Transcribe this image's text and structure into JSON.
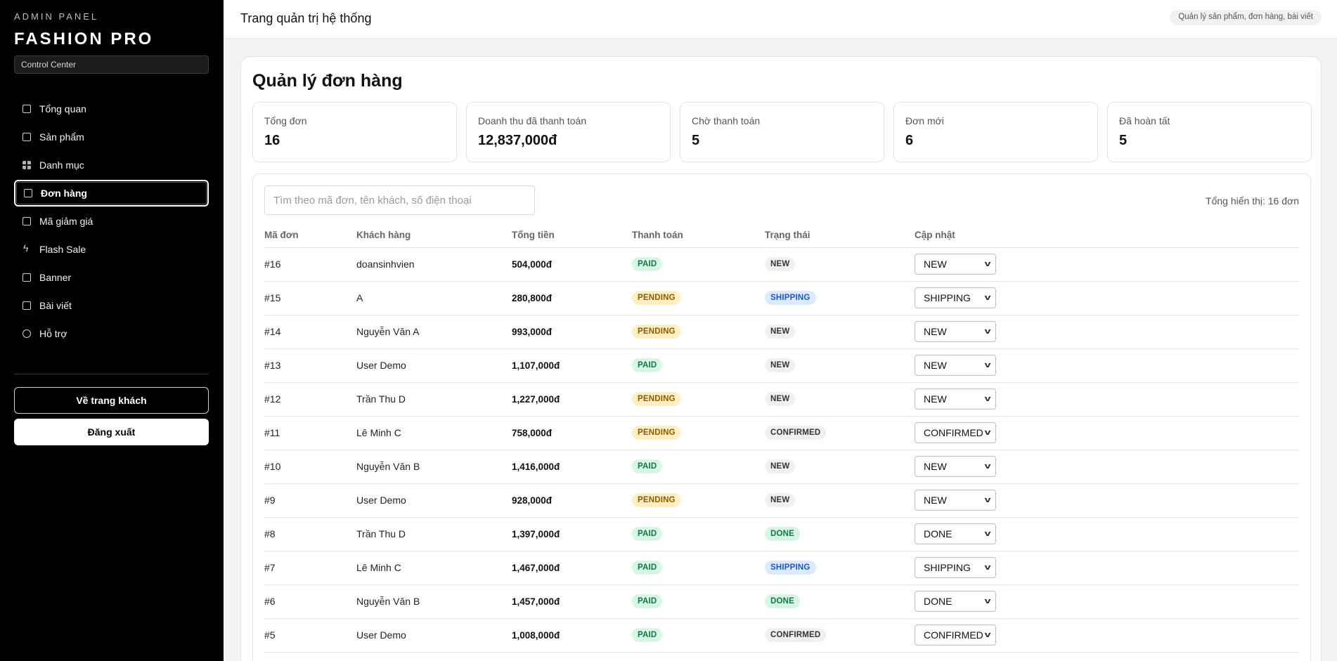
{
  "sidebar": {
    "brand_small": "ADMIN PANEL",
    "brand_big": "FASHION PRO",
    "brand_sub": "Control Center",
    "items": [
      {
        "label": "Tổng quan",
        "icon": "chart-icon"
      },
      {
        "label": "Sản phẩm",
        "icon": "box-icon"
      },
      {
        "label": "Danh mục",
        "icon": "grid-icon"
      },
      {
        "label": "Đơn hàng",
        "icon": "clipboard-icon",
        "active": true
      },
      {
        "label": "Mã giảm giá",
        "icon": "ticket-icon"
      },
      {
        "label": "Flash Sale",
        "icon": "bolt-icon"
      },
      {
        "label": "Banner",
        "icon": "image-icon"
      },
      {
        "label": "Bài viết",
        "icon": "newspaper-icon"
      },
      {
        "label": "Hỗ trợ",
        "icon": "globe-icon"
      }
    ],
    "home_button": "Về trang khách",
    "logout_button": "Đăng xuất"
  },
  "header": {
    "title": "Trang quản trị hệ thống",
    "pill": "Quản lý sản phẩm, đơn hàng, bài viết"
  },
  "main": {
    "title": "Quản lý đơn hàng",
    "stats": [
      {
        "label": "Tổng đơn",
        "value": "16"
      },
      {
        "label": "Doanh thu đã thanh toán",
        "value": "12,837,000đ"
      },
      {
        "label": "Chờ thanh toán",
        "value": "5"
      },
      {
        "label": "Đơn mới",
        "value": "6"
      },
      {
        "label": "Đã hoàn tất",
        "value": "5"
      }
    ],
    "search": {
      "placeholder": "Tìm theo mã đơn, tên khách, số điện thoại",
      "value": ""
    },
    "total_note": "Tổng hiển thị: 16 đơn",
    "columns": [
      "Mã đơn",
      "Khách hàng",
      "Tổng tiền",
      "Thanh toán",
      "Trạng thái",
      "Cập nhật"
    ],
    "rows": [
      {
        "id": "#16",
        "customer": "doansinhvien",
        "total": "504,000đ",
        "payment": "PAID",
        "status": "NEW",
        "update": "NEW"
      },
      {
        "id": "#15",
        "customer": "A",
        "total": "280,800đ",
        "payment": "PENDING",
        "status": "SHIPPING",
        "update": "SHIPPING"
      },
      {
        "id": "#14",
        "customer": "Nguyễn Văn A",
        "total": "993,000đ",
        "payment": "PENDING",
        "status": "NEW",
        "update": "NEW"
      },
      {
        "id": "#13",
        "customer": "User Demo",
        "total": "1,107,000đ",
        "payment": "PAID",
        "status": "NEW",
        "update": "NEW"
      },
      {
        "id": "#12",
        "customer": "Trần Thu D",
        "total": "1,227,000đ",
        "payment": "PENDING",
        "status": "NEW",
        "update": "NEW"
      },
      {
        "id": "#11",
        "customer": "Lê Minh C",
        "total": "758,000đ",
        "payment": "PENDING",
        "status": "CONFIRMED",
        "update": "CONFIRMED"
      },
      {
        "id": "#10",
        "customer": "Nguyễn Văn B",
        "total": "1,416,000đ",
        "payment": "PAID",
        "status": "NEW",
        "update": "NEW"
      },
      {
        "id": "#9",
        "customer": "User Demo",
        "total": "928,000đ",
        "payment": "PENDING",
        "status": "NEW",
        "update": "NEW"
      },
      {
        "id": "#8",
        "customer": "Trần Thu D",
        "total": "1,397,000đ",
        "payment": "PAID",
        "status": "DONE",
        "update": "DONE"
      },
      {
        "id": "#7",
        "customer": "Lê Minh C",
        "total": "1,467,000đ",
        "payment": "PAID",
        "status": "SHIPPING",
        "update": "SHIPPING"
      },
      {
        "id": "#6",
        "customer": "Nguyễn Văn B",
        "total": "1,457,000đ",
        "payment": "PAID",
        "status": "DONE",
        "update": "DONE"
      },
      {
        "id": "#5",
        "customer": "User Demo",
        "total": "1,008,000đ",
        "payment": "PAID",
        "status": "CONFIRMED",
        "update": "CONFIRMED"
      }
    ]
  }
}
